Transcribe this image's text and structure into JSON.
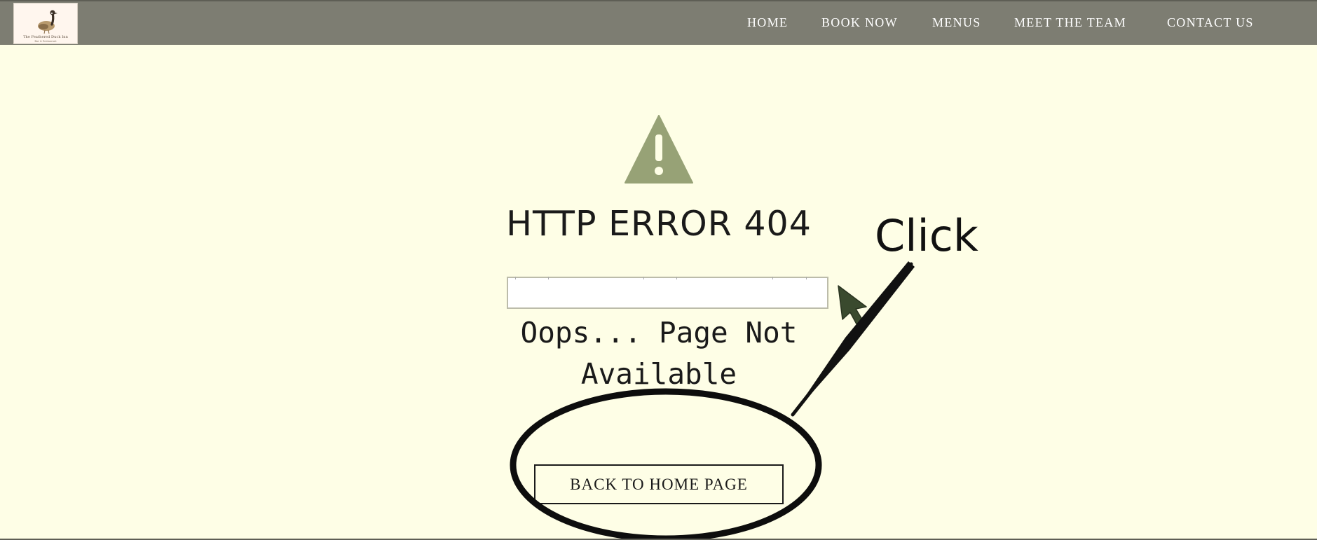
{
  "header": {
    "logo": {
      "name": "The Feathered Duck Inn",
      "tagline": "Bar & Restaurant"
    },
    "nav": [
      {
        "label": "HOME"
      },
      {
        "label": "BOOK NOW"
      },
      {
        "label": "MENUS"
      },
      {
        "label": "MEET THE TEAM"
      },
      {
        "label": "CONTACT US"
      }
    ]
  },
  "main": {
    "icon": "warning-triangle-icon",
    "title": "HTTP ERROR 404",
    "message": "Oops... Page Not Available",
    "button_label": "BACK TO HOME PAGE"
  },
  "annotation": {
    "text": "Click"
  },
  "colors": {
    "header_bg": "#7d7d72",
    "page_bg": "#fefee6",
    "icon": "#97a276",
    "text": "#1a1a1a",
    "cursor": "#3a4a2e"
  }
}
